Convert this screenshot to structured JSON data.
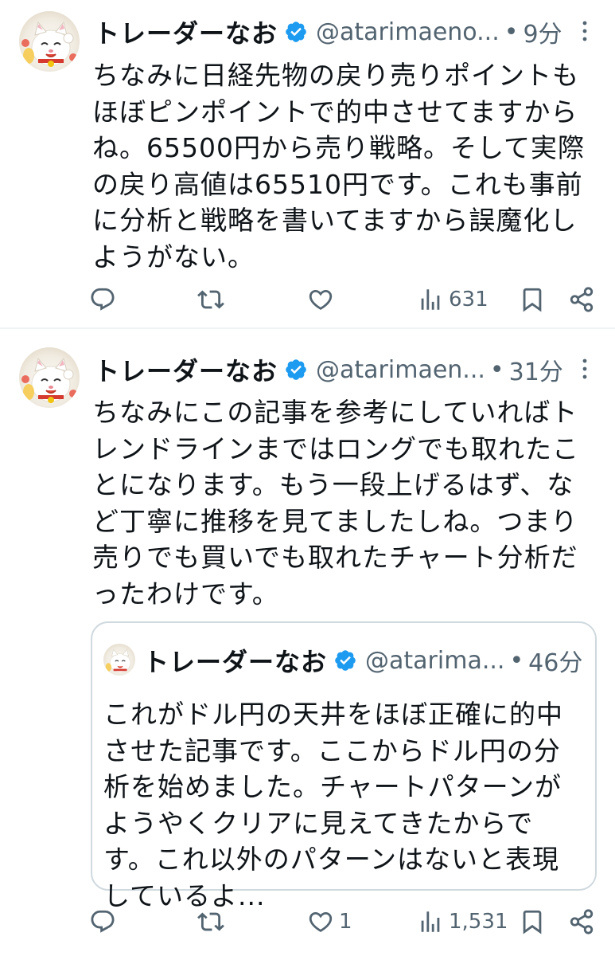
{
  "tweets": [
    {
      "author": {
        "name": "トレーダーなお",
        "handle": "@atarimaeno...",
        "time": "9分"
      },
      "text": "ちなみに日経先物の戻り売りポイントもほぼピンポイントで的中させてますからね。65500円から売り戦略。そして実際の戻り高値は65510円です。これも事前に分析と戦略を書いてますから誤魔化しようがない。",
      "metrics": {
        "replies": "",
        "retweets": "",
        "likes": "",
        "views": "631"
      }
    },
    {
      "author": {
        "name": "トレーダーなお",
        "handle": "@atarimaen...",
        "time": "31分"
      },
      "text": "ちなみにこの記事を参考にしていればトレンドラインまではロングでも取れたことになります。もう一段上げるはず、など丁寧に推移を見てましたしね。つまり売りでも買いでも取れたチャート分析だったわけです。",
      "quote": {
        "name": "トレーダーなお",
        "handle": "@atarima...",
        "time": "46分",
        "text": "これがドル円の天井をほぼ正確に的中させた記事です。ここからドル円の分析を始めました。チャートパターンがようやくクリアに見えてきたからです。これ以外のパターンはないと表現しているよ..."
      },
      "metrics": {
        "replies": "",
        "retweets": "",
        "likes": "1",
        "views": "1,531"
      }
    }
  ],
  "separator": "•",
  "colors": {
    "text": "#0f1419",
    "secondary": "#536471",
    "verified": "#1d9bf0",
    "border": "#cfd9de",
    "divider": "#eff3f4"
  },
  "icons": [
    "reply-icon",
    "retweet-icon",
    "like-icon",
    "views-icon",
    "bookmark-icon",
    "share-icon",
    "more-icon",
    "verified-badge-icon"
  ]
}
